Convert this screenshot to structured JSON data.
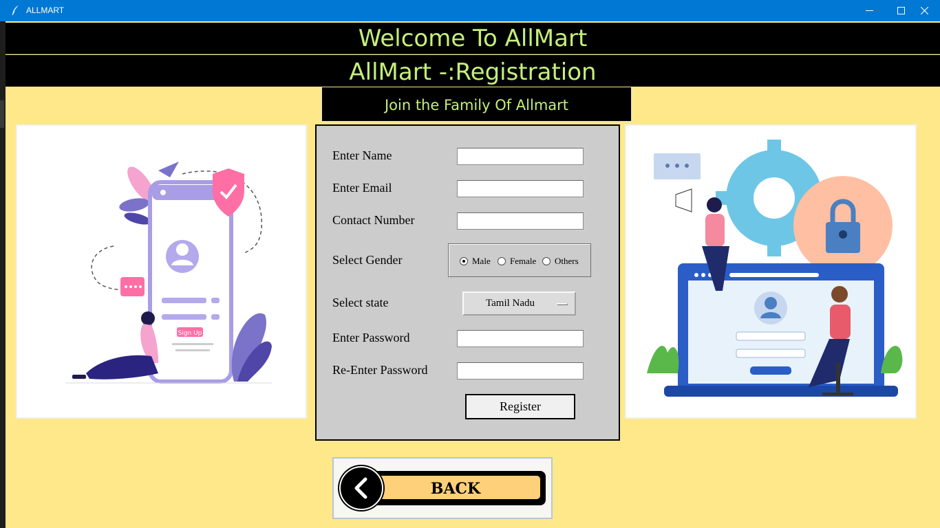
{
  "window": {
    "title": "ALLMART",
    "controls": {
      "minimize_icon": "minimize-icon",
      "maximize_icon": "maximize-icon",
      "close_icon": "close-icon"
    }
  },
  "header": {
    "welcome": "Welcome To AllMart",
    "registration": "AllMart -:Registration",
    "tagline": "Join the Family Of Allmart"
  },
  "form": {
    "name_label": "Enter Name",
    "email_label": "Enter Email",
    "contact_label": "Contact Number",
    "gender_label": "Select Gender",
    "gender_options": [
      "Male",
      "Female",
      "Others"
    ],
    "gender_selected": "Male",
    "state_label": "Select state",
    "state_value": "Tamil Nadu",
    "password_label": "Enter Password",
    "reenter_password_label": "Re-Enter Password",
    "name_value": "",
    "email_value": "",
    "contact_value": "",
    "password_value": "",
    "reenter_password_value": "",
    "register_label": "Register"
  },
  "back_button": {
    "label": "BACK",
    "icon": "chevron-left-icon"
  },
  "illustrations": {
    "left": {
      "signup_label": "Sign Up",
      "icon": "phone-signup-illustration"
    },
    "right": {
      "icon": "security-settings-illustration"
    }
  },
  "colors": {
    "background": "#ffe889",
    "banner": "#000000",
    "banner_text": "#c4f07a",
    "titlebar": "#0078d4",
    "form_bg": "#cccccc",
    "back_fill": "#ffd07a"
  }
}
